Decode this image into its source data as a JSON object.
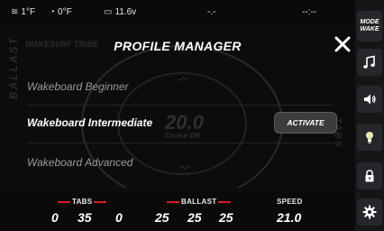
{
  "status_bar": {
    "water_temp": "1°F",
    "air_temp": "0°F",
    "battery": "11.6v",
    "field_1": "-.-",
    "field_2": "--:--"
  },
  "background": {
    "wakesurf_label": "WAKESURF TRIBE",
    "ballast_label": "BALLAST",
    "tabs_label": "TABS",
    "speed_value": "20.0",
    "speed_state": "Cruise Off"
  },
  "modal": {
    "title": "PROFILE MANAGER",
    "profiles": [
      {
        "name": "Wakeboard Beginner",
        "selected": false
      },
      {
        "name": "Wakeboard Intermediate",
        "selected": true
      },
      {
        "name": "Wakeboard Advanced",
        "selected": false
      }
    ],
    "activate_label": "ACTIVATE"
  },
  "readouts": {
    "tabs_label": "TABS",
    "tabs": [
      "0",
      "35",
      "0"
    ],
    "ballast_label": "BALLAST",
    "ballast": [
      "25",
      "25",
      "25"
    ],
    "speed_label": "SPEED",
    "speed": "21.0"
  },
  "sidebar": {
    "mode_line1": "MODE",
    "mode_line2": "WAKE",
    "icons": [
      "music-icon",
      "volume-icon",
      "light-icon",
      "lock-icon",
      "gear-icon"
    ]
  },
  "colors": {
    "accent_red": "#d61f1f",
    "background": "#0b0c0d",
    "button": "#3b3c3e"
  }
}
